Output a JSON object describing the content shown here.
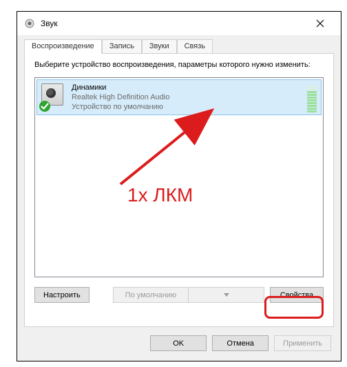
{
  "window": {
    "title": "Звук"
  },
  "tabs": {
    "items": [
      {
        "label": "Воспроизведение"
      },
      {
        "label": "Запись"
      },
      {
        "label": "Звуки"
      },
      {
        "label": "Связь"
      }
    ]
  },
  "panel": {
    "instruction": "Выберите устройство воспроизведения, параметры которого нужно изменить:"
  },
  "devices": [
    {
      "name": "Динамики",
      "description": "Realtek High Definition Audio",
      "default_text": "Устройство по умолчанию"
    }
  ],
  "buttons": {
    "configure": "Настроить",
    "set_default": "По умолчанию",
    "properties": "Свойства",
    "ok": "OK",
    "cancel": "Отмена",
    "apply": "Применить"
  },
  "annotation": {
    "text": "1x ЛКМ"
  }
}
